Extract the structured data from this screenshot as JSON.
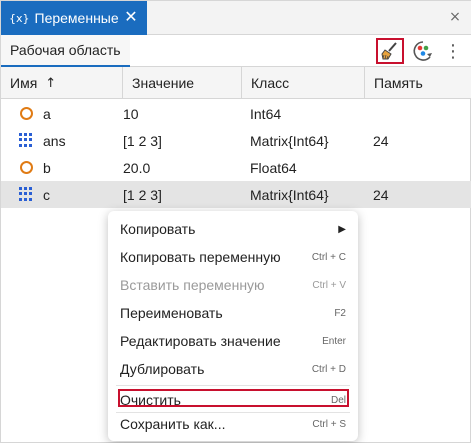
{
  "tab": {
    "icon": "{x}",
    "title": "Переменные",
    "close": "✕"
  },
  "window": {
    "close": "×"
  },
  "subtab": {
    "label": "Рабочая область"
  },
  "toolbar": {
    "more": "⋮"
  },
  "table": {
    "headers": {
      "name": "Имя",
      "sort": "↑",
      "value": "Значение",
      "class": "Класс",
      "memory": "Память"
    },
    "rows": [
      {
        "icon": "scalar-icon",
        "name": "a",
        "value": "10",
        "class": "Int64",
        "memory": ""
      },
      {
        "icon": "matrix-icon",
        "name": "ans",
        "value": "[1 2 3]",
        "class": "Matrix{Int64}",
        "memory": "24"
      },
      {
        "icon": "scalar-icon",
        "name": "b",
        "value": "20.0",
        "class": "Float64",
        "memory": ""
      },
      {
        "icon": "matrix-icon",
        "name": "c",
        "value": "[1 2 3]",
        "class": "Matrix{Int64}",
        "memory": "24"
      }
    ]
  },
  "menu": {
    "items": [
      {
        "label": "Копировать",
        "shortcut": "",
        "submenu": "▶",
        "disabled": false
      },
      {
        "label": "Копировать переменную",
        "shortcut": "Ctrl + C",
        "disabled": false
      },
      {
        "label": "Вставить переменную",
        "shortcut": "Ctrl + V",
        "disabled": true
      },
      {
        "label": "Переименовать",
        "shortcut": "F2",
        "disabled": false
      },
      {
        "label": "Редактировать значение",
        "shortcut": "Enter",
        "disabled": false
      },
      {
        "label": "Дублировать",
        "shortcut": "Ctrl + D",
        "disabled": false
      },
      {
        "label": "Очистить",
        "shortcut": "Del",
        "disabled": false
      },
      {
        "label": "Сохранить как...",
        "shortcut": "Ctrl + S",
        "disabled": false
      }
    ]
  },
  "colors": {
    "accent": "#1a6cbf",
    "highlight": "#c8102e",
    "scalar": "#e07b14",
    "matrix": "#2a5fd4"
  }
}
